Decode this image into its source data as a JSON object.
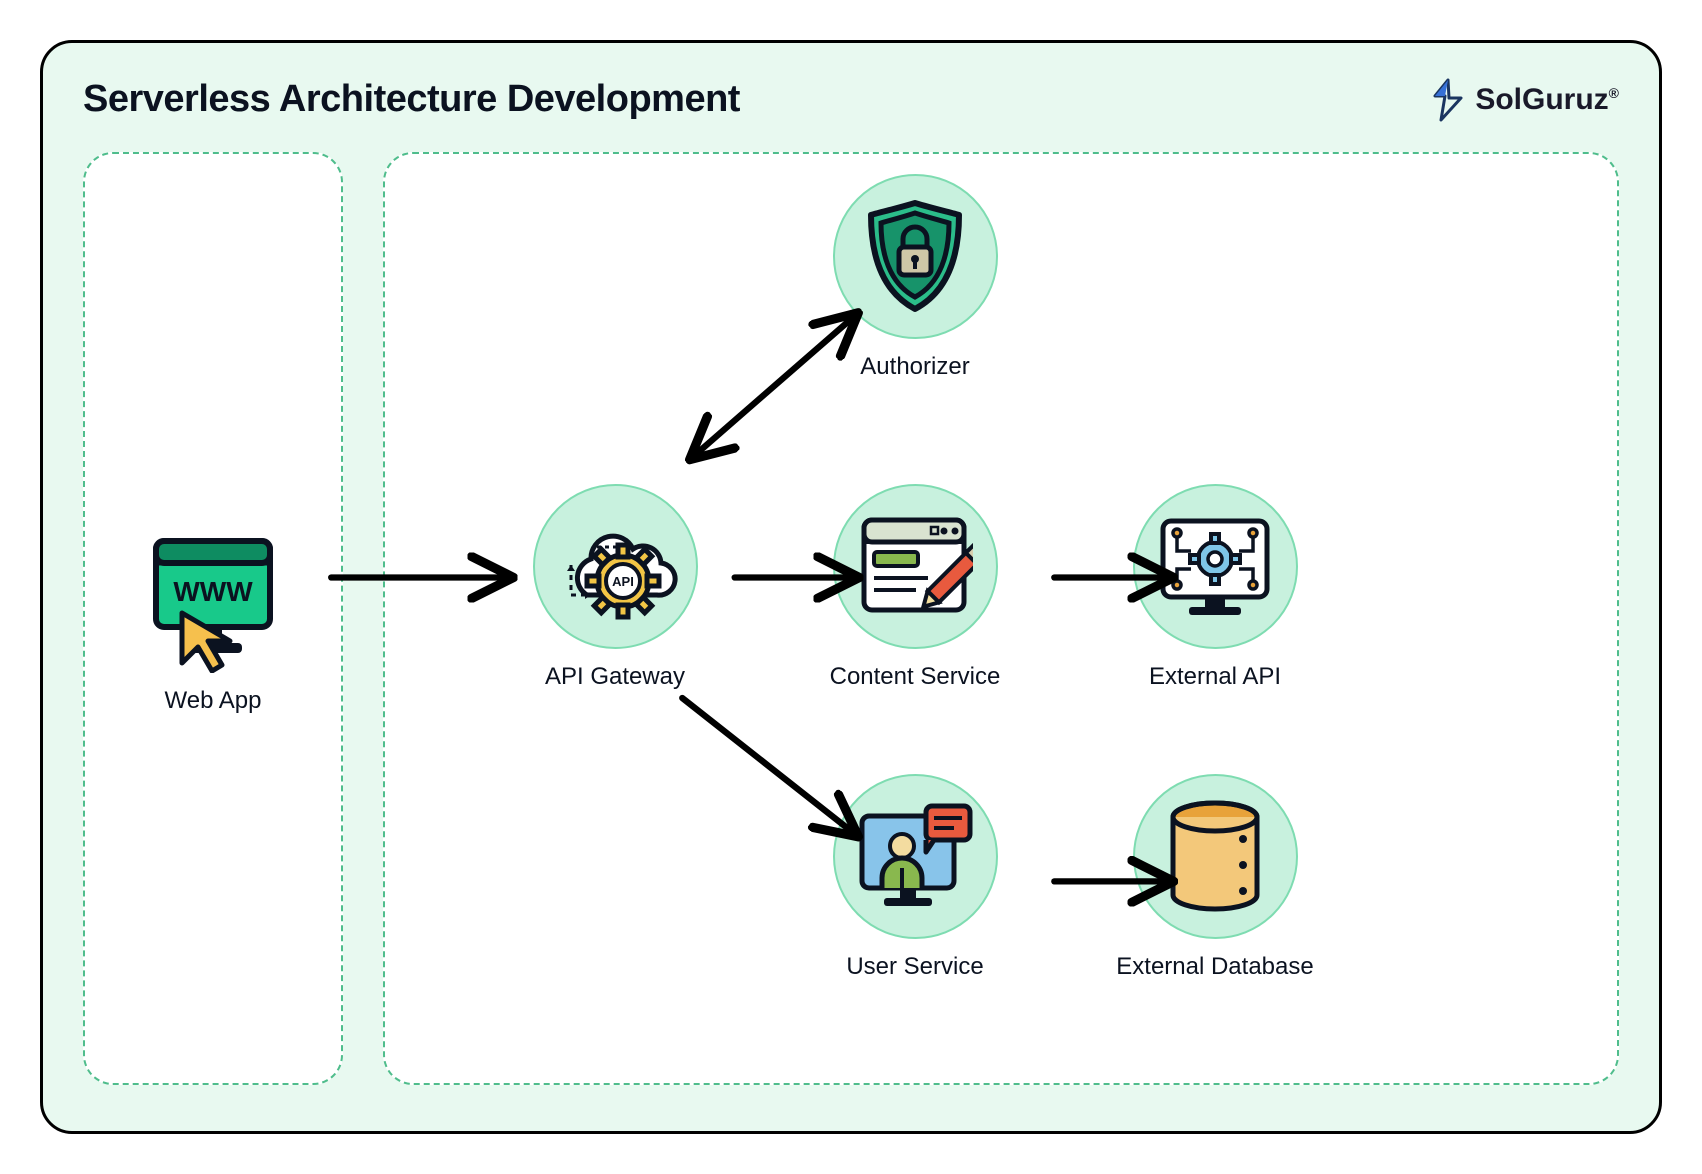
{
  "title": "Serverless Architecture Development",
  "brand": {
    "name": "SolGuruz",
    "trademark": "®"
  },
  "nodes": {
    "webapp": {
      "label": "Web App",
      "icon": "www-monitor"
    },
    "api_gateway": {
      "label": "API Gateway",
      "icon": "cloud-gear-api"
    },
    "authorizer": {
      "label": "Authorizer",
      "icon": "shield-lock"
    },
    "content_service": {
      "label": "Content Service",
      "icon": "browser-edit"
    },
    "user_service": {
      "label": "User Service",
      "icon": "user-chat-monitor"
    },
    "external_api": {
      "label": "External API",
      "icon": "circuit-gear-monitor"
    },
    "external_database": {
      "label": "External Database",
      "icon": "database-cylinder"
    }
  },
  "edges": [
    {
      "from": "webapp",
      "to": "api_gateway",
      "bidirectional": false
    },
    {
      "from": "api_gateway",
      "to": "authorizer",
      "bidirectional": true
    },
    {
      "from": "api_gateway",
      "to": "content_service",
      "bidirectional": false
    },
    {
      "from": "api_gateway",
      "to": "user_service",
      "bidirectional": false
    },
    {
      "from": "content_service",
      "to": "external_api",
      "bidirectional": false
    },
    {
      "from": "user_service",
      "to": "external_database",
      "bidirectional": false
    }
  ],
  "colors": {
    "panel_bg": "#e8f9f0",
    "dashed_border": "#4fbd8c",
    "circle_fill": "#c8f1de",
    "circle_stroke": "#7edcb1",
    "arrow": "#000000"
  }
}
